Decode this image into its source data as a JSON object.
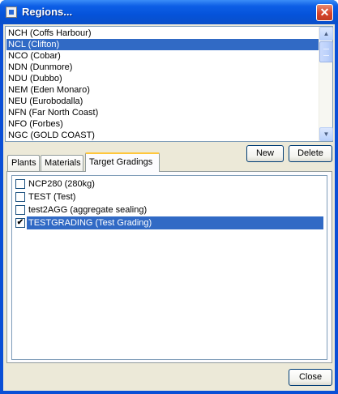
{
  "window": {
    "title": "Regions...",
    "close_glyph": "✕"
  },
  "regions": {
    "items": [
      {
        "label": "NCH (Coffs Harbour)",
        "selected": false
      },
      {
        "label": "NCL (Clifton)",
        "selected": true
      },
      {
        "label": "NCO (Cobar)",
        "selected": false
      },
      {
        "label": "NDN (Dunmore)",
        "selected": false
      },
      {
        "label": "NDU (Dubbo)",
        "selected": false
      },
      {
        "label": "NEM (Eden Monaro)",
        "selected": false
      },
      {
        "label": "NEU (Eurobodalla)",
        "selected": false
      },
      {
        "label": "NFN (Far North Coast)",
        "selected": false
      },
      {
        "label": "NFO (Forbes)",
        "selected": false
      },
      {
        "label": "NGC (GOLD COAST)",
        "selected": false
      }
    ]
  },
  "buttons": {
    "new_label": "New",
    "delete_label": "Delete",
    "close_label": "Close"
  },
  "tabs": [
    {
      "label": "Plants",
      "active": false
    },
    {
      "label": "Materials",
      "active": false
    },
    {
      "label": "Target Gradings",
      "active": true
    }
  ],
  "gradings": {
    "items": [
      {
        "label": "NCP280 (280kg)",
        "checked": false,
        "selected": false
      },
      {
        "label": "TEST (Test)",
        "checked": false,
        "selected": false
      },
      {
        "label": "test2AGG (aggregate sealing)",
        "checked": false,
        "selected": false
      },
      {
        "label": "TESTGRADING (Test Grading)",
        "checked": true,
        "selected": true
      }
    ]
  },
  "colors": {
    "titlebar": "#0a4fd6",
    "selection": "#316ac5",
    "dialog_face": "#ece9d8",
    "tab_highlight": "#ffc73c"
  }
}
